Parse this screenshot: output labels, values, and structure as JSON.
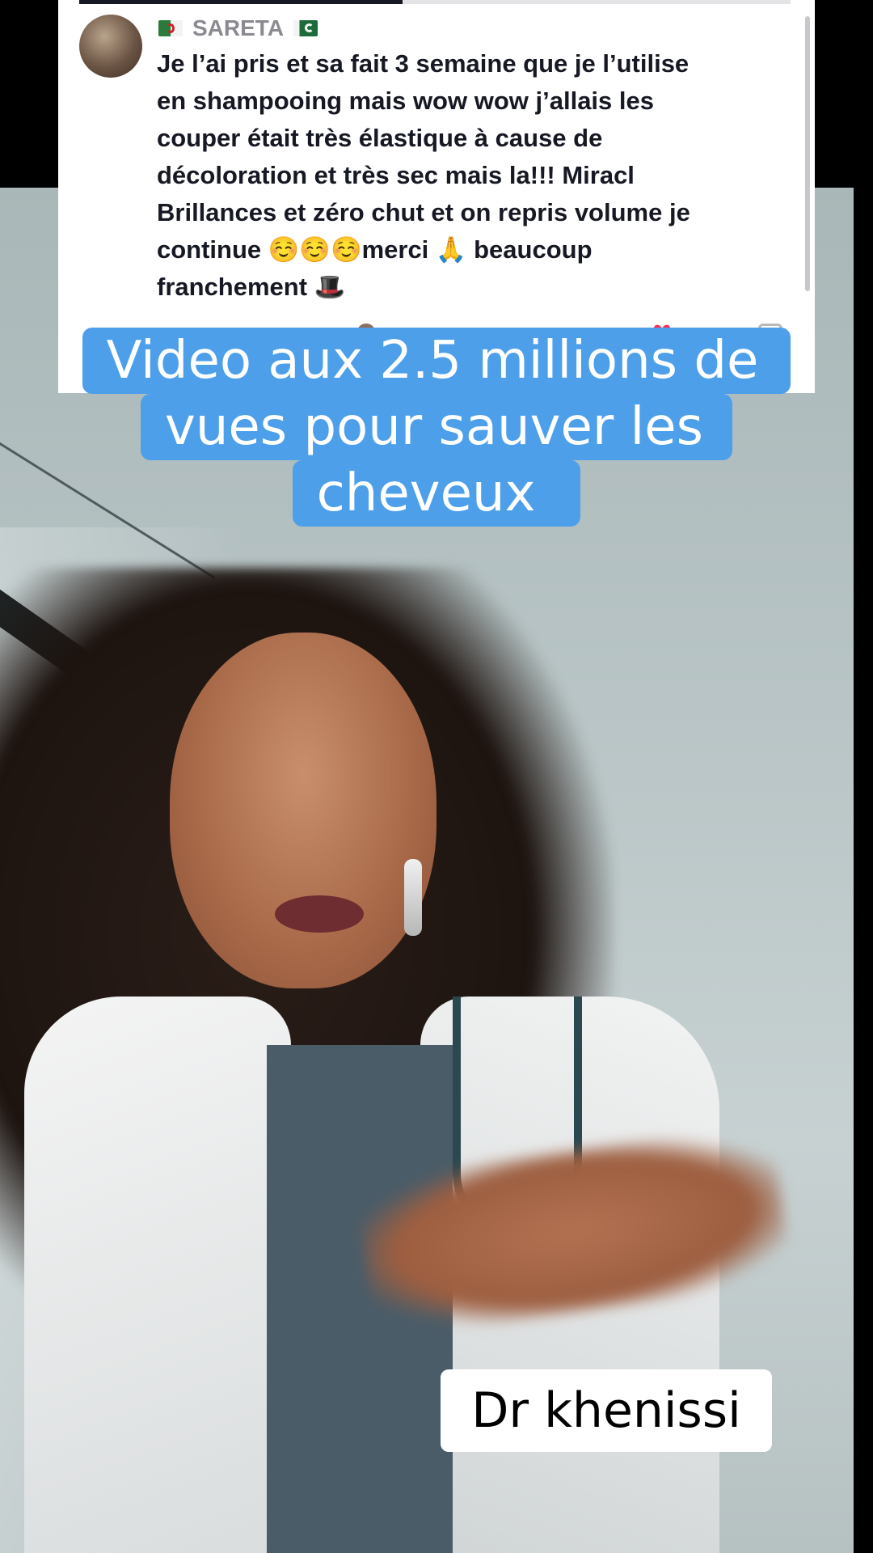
{
  "comment": {
    "username": "SARETA",
    "flag_left": "algeria-flag-icon",
    "flag_right": "pakistan-flag-icon",
    "text": "Je l’ai pris et sa fait 3 semaine que je l’utilise\nen shampooing mais wow wow j’allais les\ncouper était très élastique à cause de\ndécoloration et très sec mais la!!! Miracl\nBrillances et zéro chut et on repris volume je\ncontinue ☺️☺️☺️merci 🙏 beaucoup\nfranchement 🎩"
  },
  "captions": {
    "line1": "Video aux 2.5 millions de",
    "line2": "vues pour sauver les",
    "line3": "cheveux"
  },
  "name_tag": "Dr khenissi",
  "colors": {
    "caption_bg": "#4d9fea",
    "username": "#8a8b91",
    "comment_text": "#161823"
  }
}
